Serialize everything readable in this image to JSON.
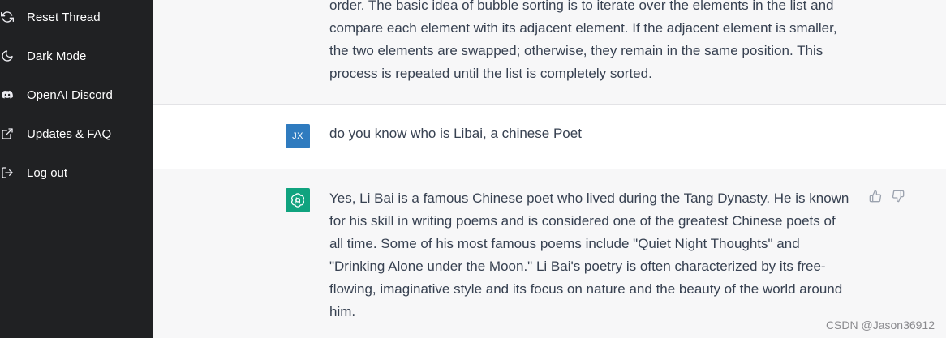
{
  "sidebar": {
    "items": [
      {
        "label": "Reset Thread",
        "icon": "refresh-icon"
      },
      {
        "label": "Dark Mode",
        "icon": "moon-icon"
      },
      {
        "label": "OpenAI Discord",
        "icon": "discord-icon"
      },
      {
        "label": "Updates & FAQ",
        "icon": "external-link-icon"
      },
      {
        "label": "Log out",
        "icon": "logout-icon"
      }
    ]
  },
  "conversation": {
    "prev_assistant": {
      "lines": [
        "order. The basic idea of bubble sorting is to iterate over the elements in the list and",
        "compare each element with its adjacent element. If the adjacent element is smaller,",
        "the two elements are swapped; otherwise, they remain in the same position. This",
        "process is repeated until the list is completely sorted."
      ]
    },
    "user": {
      "avatar_initials": "JX",
      "text": "do you know who is Libai, a chinese Poet"
    },
    "assistant": {
      "lines": [
        "Yes, Li Bai is a famous Chinese poet who lived during the Tang Dynasty. He is known",
        "for his skill in writing poems and is considered one of the greatest Chinese poets of",
        "all time. Some of his most famous poems include \"Quiet Night Thoughts\" and",
        "\"Drinking Alone under the Moon.\" Li Bai's poetry is often characterized by its free-",
        "flowing, imaginative style and its focus on nature and the beauty of the world around",
        "him."
      ]
    }
  },
  "watermark": "CSDN @Jason36912",
  "colors": {
    "sidebar_bg": "#202123",
    "user_avatar": "#2f7bbf",
    "bot_avatar": "#10a37f"
  }
}
